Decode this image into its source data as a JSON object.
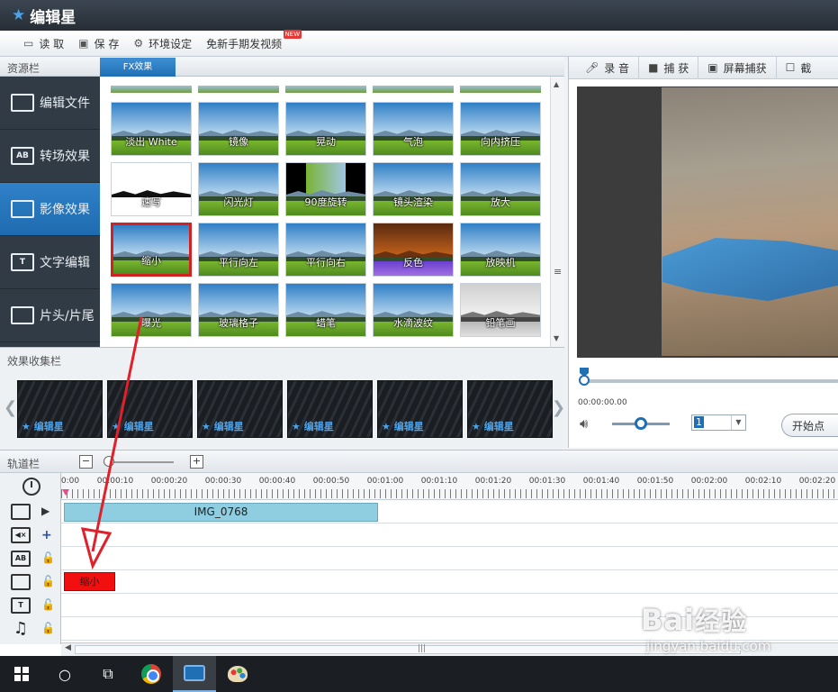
{
  "app": {
    "title": "编辑星",
    "logo_icon": "star-icon"
  },
  "toolbar": {
    "items": [
      {
        "label": "读 取",
        "icon": "folder-open-icon"
      },
      {
        "label": "保 存",
        "icon": "floppy-disk-icon"
      },
      {
        "label": "环境设定",
        "icon": "gear-icon"
      },
      {
        "label": "免新手期发视频",
        "badge": "NEW"
      }
    ]
  },
  "resource": {
    "label": "资源栏",
    "fx_tab": "FX效果"
  },
  "nav": {
    "items": [
      {
        "label": "编辑文件",
        "icon": "film-icon",
        "glyph": ""
      },
      {
        "label": "转场效果",
        "icon": "transition-ab-icon",
        "glyph": "AB"
      },
      {
        "label": "影像效果",
        "icon": "image-effect-icon",
        "glyph": "",
        "active": true
      },
      {
        "label": "文字编辑",
        "icon": "text-t-icon",
        "glyph": "T"
      },
      {
        "label": "片头/片尾",
        "icon": "opening-ending-icon",
        "glyph": ""
      }
    ]
  },
  "effects": {
    "rows": [
      [
        "淡出 White",
        "镜像",
        "晃动",
        "气泡",
        "向内挤压"
      ],
      [
        "速写",
        "闪光灯",
        "90度旋转",
        "镜头渲染",
        "放大"
      ],
      [
        "缩小",
        "平行向左",
        "平行向右",
        "反色",
        "放映机"
      ],
      [
        "曝光",
        "玻璃格子",
        "蜡笔",
        "水滴波纹",
        "铅笔画"
      ]
    ],
    "selected": "缩小"
  },
  "collection": {
    "label": "效果收集栏",
    "items": [
      "编辑星",
      "编辑星",
      "编辑星",
      "编辑星",
      "编辑星",
      "编辑星"
    ]
  },
  "right_tools": {
    "items": [
      {
        "label": "录 音",
        "icon": "microphone-icon"
      },
      {
        "label": "捕 获",
        "icon": "camera-icon"
      },
      {
        "label": "屏幕捕获",
        "icon": "screen-capture-icon"
      },
      {
        "label": "截",
        "icon": "snapshot-icon"
      }
    ]
  },
  "player": {
    "timecode": "00:00:00.00",
    "speed": "1",
    "start_label": "开始点",
    "volume_level": 0.5,
    "seek_position": 0
  },
  "track": {
    "label": "轨道栏",
    "zoom_minus": "−",
    "zoom_plus": "+",
    "ruler": [
      "0:00",
      "00:00:10",
      "00:00:20",
      "00:00:30",
      "00:00:40",
      "00:00:50",
      "00:01:00",
      "00:01:10",
      "00:01:20",
      "00:01:30",
      "00:01:40",
      "00:01:50",
      "00:02:00",
      "00:02:10",
      "00:02:20"
    ],
    "video_clip": "IMG_0768",
    "fx_clip": "缩小",
    "row_icons": [
      {
        "icon": "video-track-icon",
        "glyph": "",
        "action": "▶"
      },
      {
        "icon": "mute-audio-icon",
        "glyph": "◀×",
        "action": "+"
      },
      {
        "icon": "transition-track-icon",
        "glyph": "AB",
        "action": "🔓"
      },
      {
        "icon": "fx-track-icon",
        "glyph": "",
        "action": "🔓"
      },
      {
        "icon": "text-track-icon",
        "glyph": "T",
        "action": "🔓"
      },
      {
        "icon": "music-track-icon",
        "glyph": "♫",
        "action": "🔓"
      }
    ]
  },
  "taskbar": {
    "apps": [
      "windows-start-icon",
      "cortana-icon",
      "task-view-icon",
      "chrome-icon",
      "video-editor-icon",
      "paint-icon"
    ]
  },
  "watermark": {
    "big": "Bai",
    "mid": "经验",
    "small": "jingyan.baidu.com"
  }
}
